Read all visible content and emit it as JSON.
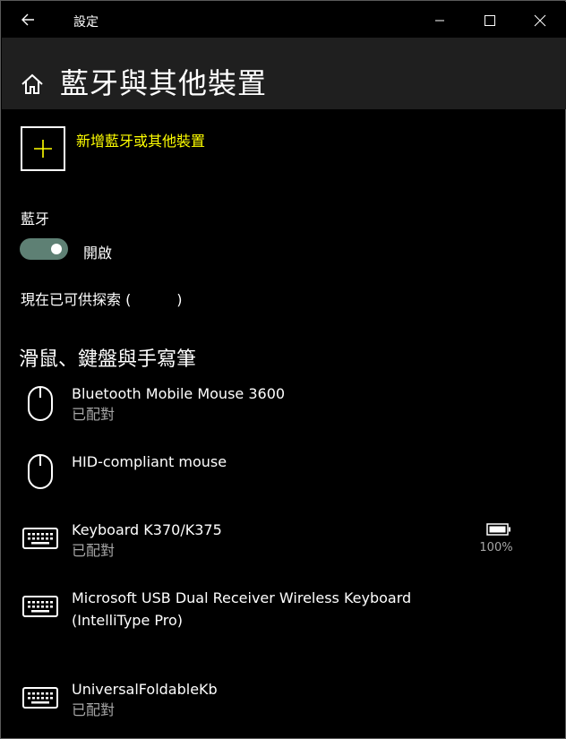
{
  "window": {
    "title": "設定",
    "back_icon": "back-arrow-icon",
    "min_icon": "minimize-icon",
    "max_icon": "maximize-icon",
    "close_icon": "close-icon"
  },
  "header": {
    "title": "藍牙與其他裝置",
    "home_icon": "home-icon"
  },
  "add_device": {
    "label": "新增藍牙或其他裝置",
    "icon": "plus-icon",
    "accent": "#ffff00"
  },
  "bluetooth": {
    "section_label": "藍牙",
    "toggle_state": "開啟",
    "toggle_on": true,
    "toggle_color": "#5e8074",
    "discoverable_text": "現在已可供探索 (          )"
  },
  "group": {
    "title": "滑鼠、鍵盤與手寫筆",
    "devices": [
      {
        "name": "Bluetooth Mobile Mouse 3600",
        "status": "已配對",
        "icon": "mouse-icon"
      },
      {
        "name": "HID-compliant mouse",
        "status": "",
        "icon": "mouse-icon"
      },
      {
        "name": "Keyboard K370/K375",
        "status": "已配對",
        "icon": "keyboard-icon",
        "battery": "100%",
        "battery_icon": "battery-icon"
      },
      {
        "name": "Microsoft USB Dual Receiver Wireless Keyboard",
        "name2": "(IntelliType Pro)",
        "status": "",
        "icon": "keyboard-icon"
      },
      {
        "name": "UniversalFoldableKb",
        "status": "已配對",
        "icon": "keyboard-icon"
      }
    ]
  }
}
